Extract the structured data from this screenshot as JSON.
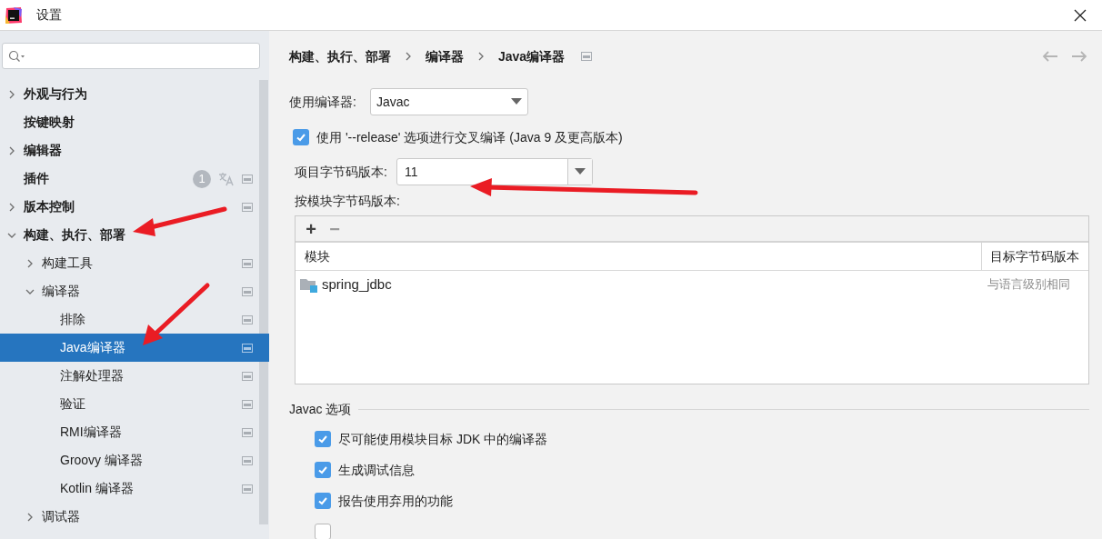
{
  "window": {
    "title": "设置"
  },
  "sidebar": {
    "items": [
      {
        "label": "外观与行为",
        "kind": "folder",
        "expanded": false,
        "selected": false,
        "project_level": false
      },
      {
        "label": "按键映射",
        "kind": "leaf",
        "selected": false,
        "project_level": false
      },
      {
        "label": "编辑器",
        "kind": "folder",
        "expanded": false,
        "selected": false,
        "project_level": false
      },
      {
        "label": "插件",
        "kind": "leaf",
        "selected": false,
        "project_level": true,
        "badge": "1",
        "translate": true
      },
      {
        "label": "版本控制",
        "kind": "folder",
        "expanded": false,
        "selected": false,
        "project_level": true
      },
      {
        "label": "构建、执行、部署",
        "kind": "folder",
        "expanded": true,
        "selected": false,
        "project_level": false,
        "children": [
          {
            "label": "构建工具",
            "kind": "folder",
            "expanded": false,
            "selected": false,
            "project_level": true
          },
          {
            "label": "编译器",
            "kind": "folder",
            "expanded": true,
            "selected": false,
            "project_level": true,
            "children": [
              {
                "label": "排除",
                "kind": "leaf",
                "selected": false,
                "project_level": true
              },
              {
                "label": "Java编译器",
                "kind": "leaf",
                "selected": true,
                "project_level": true
              },
              {
                "label": "注解处理器",
                "kind": "leaf",
                "selected": false,
                "project_level": true
              },
              {
                "label": "验证",
                "kind": "leaf",
                "selected": false,
                "project_level": true
              },
              {
                "label": "RMI编译器",
                "kind": "leaf",
                "selected": false,
                "project_level": true
              },
              {
                "label": "Groovy 编译器",
                "kind": "leaf",
                "selected": false,
                "project_level": true
              },
              {
                "label": "Kotlin 编译器",
                "kind": "leaf",
                "selected": false,
                "project_level": true
              }
            ]
          },
          {
            "label": "调试器",
            "kind": "folder",
            "expanded": false,
            "selected": false,
            "project_level": false
          }
        ]
      }
    ]
  },
  "breadcrumb": [
    "构建、执行、部署",
    "编译器",
    "Java编译器"
  ],
  "compiler": {
    "label": "使用编译器:",
    "value": "Javac"
  },
  "release_option": {
    "label": "使用 '--release' 选项进行交叉编译 (Java 9 及更高版本)",
    "checked": true
  },
  "project_bytecode": {
    "label": "项目字节码版本:",
    "value": "11"
  },
  "module_bytecode": {
    "label": "按模块字节码版本:",
    "toolbar": [
      {
        "symbol": "+",
        "disabled": false
      },
      {
        "symbol": "−",
        "disabled": true
      }
    ],
    "columns": [
      "模块",
      "目标字节码版本"
    ],
    "rows": [
      {
        "module": "spring_jdbc",
        "target": "与语言级别相同"
      }
    ]
  },
  "javac_options": {
    "title": "Javac 选项",
    "options": [
      {
        "label": "尽可能使用模块目标 JDK 中的编译器",
        "checked": true
      },
      {
        "label": "生成调试信息",
        "checked": true
      },
      {
        "label": "报告使用弃用的功能",
        "checked": true
      },
      {
        "checked": false
      }
    ]
  }
}
